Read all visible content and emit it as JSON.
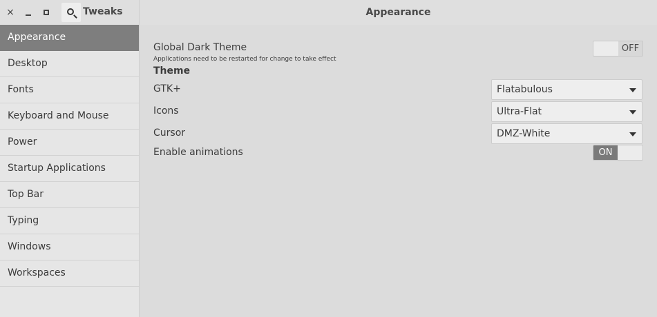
{
  "window": {
    "app_title": "Tweaks",
    "page_title": "Appearance",
    "close_glyph": "×"
  },
  "icons": {
    "close": "close-icon",
    "minimize": "minimize-icon",
    "maximize": "maximize-icon",
    "search": "search-icon"
  },
  "sidebar": {
    "items": [
      {
        "label": "Appearance",
        "active": true
      },
      {
        "label": "Desktop"
      },
      {
        "label": "Fonts"
      },
      {
        "label": "Keyboard and Mouse"
      },
      {
        "label": "Power"
      },
      {
        "label": "Startup Applications"
      },
      {
        "label": "Top Bar"
      },
      {
        "label": "Typing"
      },
      {
        "label": "Windows"
      },
      {
        "label": "Workspaces"
      }
    ]
  },
  "main": {
    "dark_theme": {
      "label": "Global Dark Theme",
      "sublabel": "Applications need to be restarted for change to take effect",
      "state": "OFF"
    },
    "theme_section": "Theme",
    "gtk": {
      "label": "GTK+",
      "value": "Flatabulous"
    },
    "icons": {
      "label": "Icons",
      "value": "Ultra-Flat"
    },
    "cursor": {
      "label": "Cursor",
      "value": "DMZ-White"
    },
    "animations": {
      "label": "Enable animations",
      "state": "ON"
    }
  },
  "colors": {
    "active_sidebar_bg": "#7e7e7e",
    "switch_on_bg": "#7a7a7a",
    "background": "#dcdcdc"
  }
}
